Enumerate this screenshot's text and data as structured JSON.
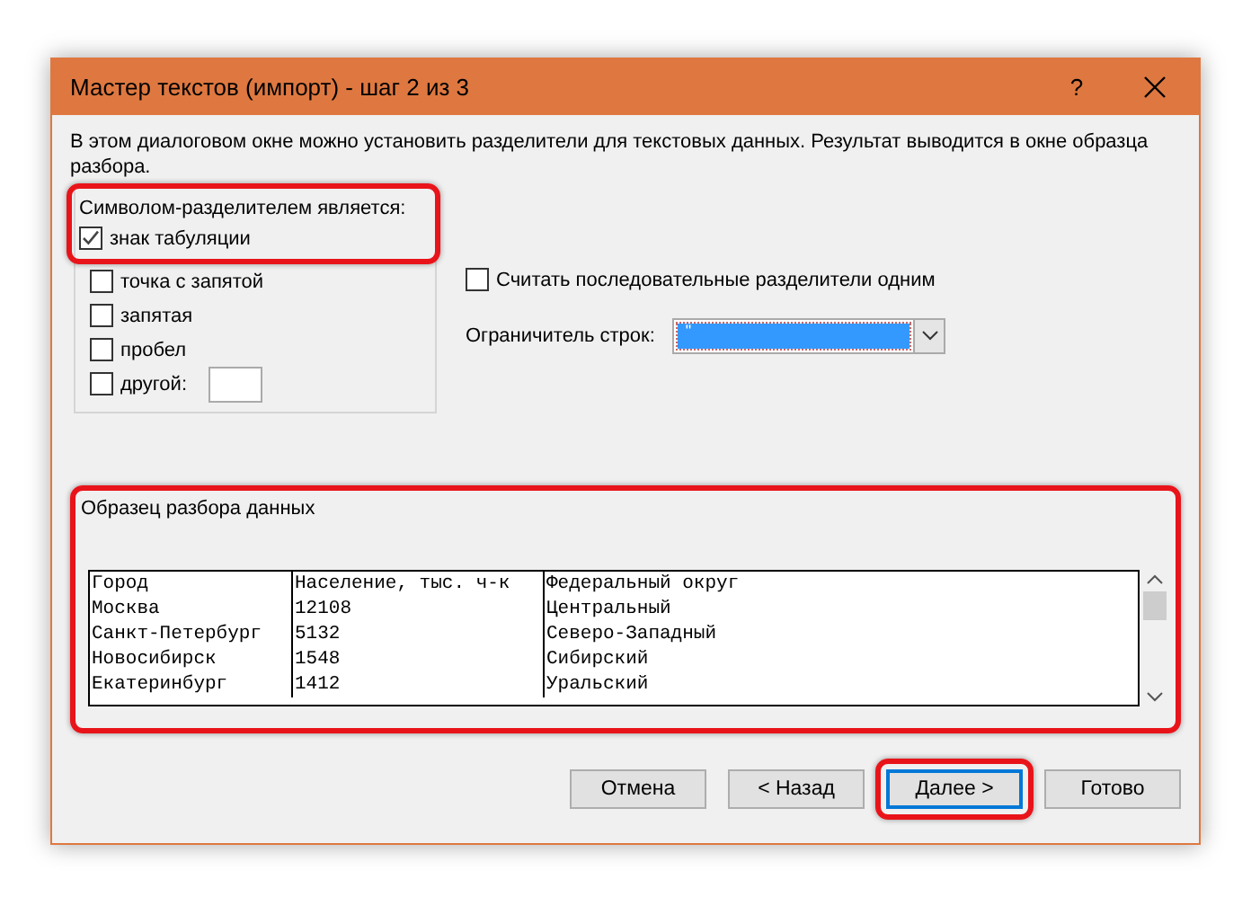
{
  "window": {
    "title": "Мастер текстов (импорт) - шаг 2 из 3",
    "help_button": "?"
  },
  "description": "В этом диалоговом окне можно установить разделители для текстовых данных. Результат выводится в окне образца разбора.",
  "delimiters": {
    "legend": "Символом-разделителем является:",
    "highlighted": true,
    "options": [
      {
        "label": "знак табуляции",
        "checked": true,
        "highlighted": true,
        "kind": "checkbox"
      },
      {
        "label": "точка с запятой",
        "checked": false,
        "highlighted": false,
        "kind": "checkbox"
      },
      {
        "label": "запятая",
        "checked": false,
        "highlighted": false,
        "kind": "checkbox"
      },
      {
        "label": "пробел",
        "checked": false,
        "highlighted": false,
        "kind": "checkbox"
      },
      {
        "label": "другой:",
        "checked": false,
        "highlighted": false,
        "kind": "checkbox-field"
      }
    ]
  },
  "consecutive": {
    "label": "Считать последовательные разделители одним",
    "checked": false
  },
  "text_qualifier": {
    "label": "Ограничитель строк:",
    "value": "\""
  },
  "preview": {
    "label": "Образец разбора данных",
    "highlighted": true,
    "rows": [
      [
        "Город",
        "Население, тыс. ч-к",
        "Федеральный округ"
      ],
      [
        "Москва",
        "12108",
        "Центральный"
      ],
      [
        "Санкт-Петербург",
        "5132",
        "Северо-Западный"
      ],
      [
        "Новосибирск",
        "1548",
        "Сибирский"
      ],
      [
        "Екатеринбург",
        "1412",
        "Уральский"
      ]
    ]
  },
  "buttons": [
    {
      "label": "Отмена",
      "default": false,
      "highlighted": false
    },
    {
      "label": "< Назад",
      "default": false,
      "highlighted": false
    },
    {
      "label": "Далее >",
      "default": true,
      "highlighted": true
    },
    {
      "label": "Готово",
      "default": false,
      "highlighted": false
    }
  ]
}
